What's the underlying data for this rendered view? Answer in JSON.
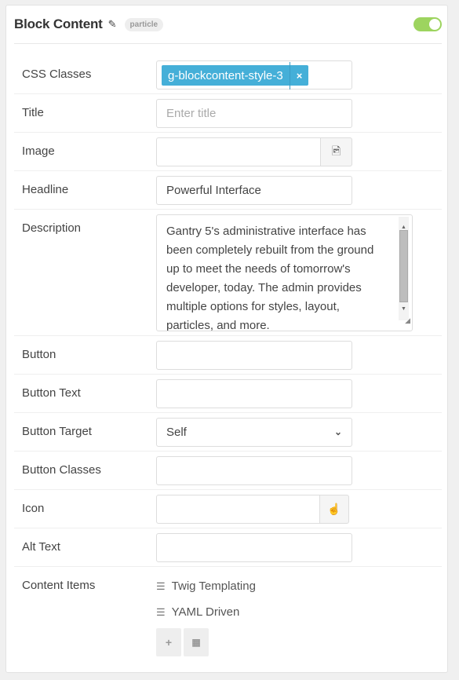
{
  "header": {
    "title": "Block Content",
    "badge": "particle",
    "enabled": true,
    "toggle_color": "#9dd45f"
  },
  "fields": {
    "css_classes": {
      "label": "CSS Classes",
      "tags": [
        "g-blockcontent-style-3"
      ],
      "tag_color": "#45afd8"
    },
    "title": {
      "label": "Title",
      "value": "",
      "placeholder": "Enter title"
    },
    "image": {
      "label": "Image",
      "value": "",
      "icon": "image-file-icon"
    },
    "headline": {
      "label": "Headline",
      "value": "Powerful Interface"
    },
    "description": {
      "label": "Description",
      "value": "Gantry 5's administrative interface has been completely rebuilt from the ground up to meet the needs of tomorrow's developer, today. The admin provides multiple options for styles, layout, particles, and more."
    },
    "button": {
      "label": "Button",
      "value": ""
    },
    "button_text": {
      "label": "Button Text",
      "value": ""
    },
    "button_target": {
      "label": "Button Target",
      "value": "Self"
    },
    "button_classes": {
      "label": "Button Classes",
      "value": ""
    },
    "icon": {
      "label": "Icon",
      "value": "",
      "icon": "hand-pointer-icon"
    },
    "alt_text": {
      "label": "Alt Text",
      "value": ""
    },
    "content_items": {
      "label": "Content Items",
      "items": [
        "Twig Templating",
        "YAML Driven"
      ]
    }
  }
}
